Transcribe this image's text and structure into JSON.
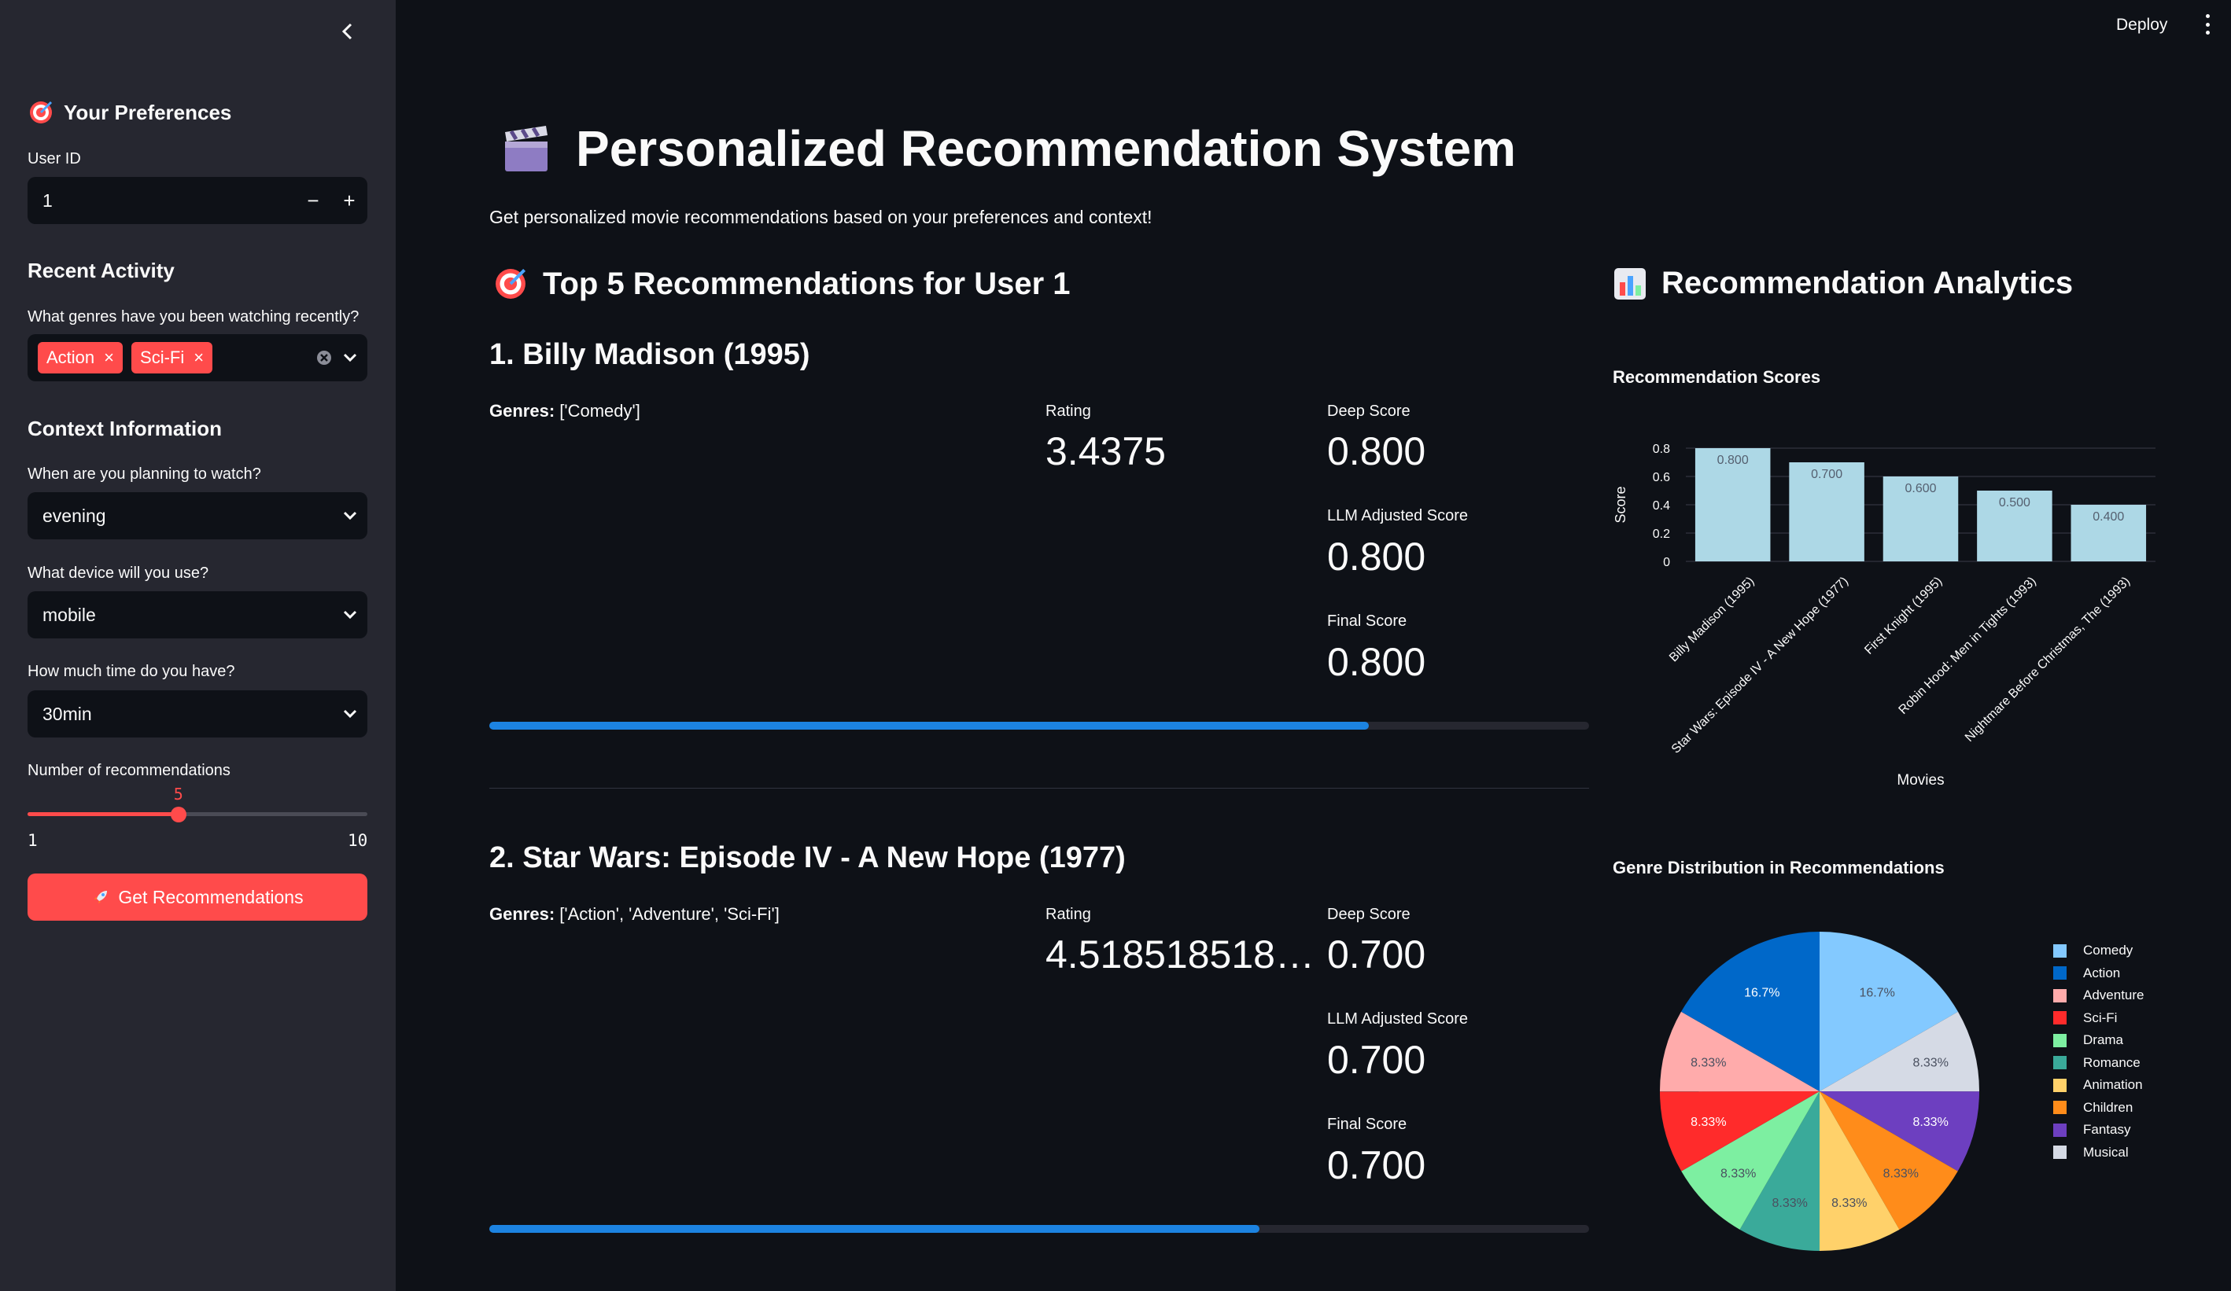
{
  "sidebar": {
    "preferences_title": "Your Preferences",
    "user_id_label": "User ID",
    "user_id_value": "1",
    "recent_activity_title": "Recent Activity",
    "genres_question": "What genres have you been watching recently?",
    "selected_genres": [
      "Action",
      "Sci-Fi"
    ],
    "context_title": "Context Information",
    "time_question": "When are you planning to watch?",
    "time_value": "evening",
    "device_question": "What device will you use?",
    "device_value": "mobile",
    "duration_question": "How much time do you have?",
    "duration_value": "30min",
    "num_recs_label": "Number of recommendations",
    "num_recs_value": "5",
    "num_recs_min": "1",
    "num_recs_max": "10",
    "slider_fraction": 0.444,
    "button_label": "Get Recommendations"
  },
  "header": {
    "deploy_label": "Deploy"
  },
  "main": {
    "title": "Personalized Recommendation System",
    "subtitle": "Get personalized movie recommendations based on your preferences and context!",
    "recs_header": "Top 5 Recommendations for User 1",
    "analytics_header": "Recommendation Analytics",
    "recommendations": [
      {
        "title": "1. Billy Madison (1995)",
        "genres_label": "Genres:",
        "genres": "['Comedy']",
        "rating_label": "Rating",
        "rating": "3.4375",
        "deep_label": "Deep Score",
        "deep": "0.800",
        "llm_label": "LLM Adjusted Score",
        "llm": "0.800",
        "final_label": "Final Score",
        "final": "0.800",
        "progress": 0.8
      },
      {
        "title": "2. Star Wars: Episode IV - A New Hope (1977)",
        "genres_label": "Genres:",
        "genres": "['Action', 'Adventure', 'Sci-Fi']",
        "rating_label": "Rating",
        "rating": "4.518518518…",
        "deep_label": "Deep Score",
        "deep": "0.700",
        "llm_label": "LLM Adjusted Score",
        "llm": "0.700",
        "final_label": "Final Score",
        "final": "0.700",
        "progress": 0.7
      }
    ]
  },
  "chart_data": [
    {
      "type": "bar",
      "title": "Recommendation Scores",
      "xlabel": "Movies",
      "ylabel": "Score",
      "categories": [
        "Billy Madison (1995)",
        "Star Wars: Episode IV - A New Hope (1977)",
        "First Knight (1995)",
        "Robin Hood: Men in Tights (1993)",
        "Nightmare Before Christmas, The (1993)"
      ],
      "values": [
        0.8,
        0.7,
        0.6,
        0.5,
        0.4
      ],
      "value_labels": [
        "0.800",
        "0.700",
        "0.600",
        "0.500",
        "0.400"
      ],
      "yticks": [
        "0",
        "0.2",
        "0.4",
        "0.6",
        "0.8"
      ],
      "ylim": [
        0,
        0.8
      ],
      "color": "#add8e6",
      "grid": true
    },
    {
      "type": "pie",
      "title": "Genre Distribution in Recommendations",
      "legend_position": "right",
      "slices": [
        {
          "label": "Comedy",
          "value": 16.7,
          "text": "16.7%",
          "color": "#83c9ff"
        },
        {
          "label": "Musical",
          "value": 8.33,
          "text": "8.33%",
          "color": "#d5dae5"
        },
        {
          "label": "Fantasy",
          "value": 8.33,
          "text": "8.33%",
          "color": "#6d3fc0"
        },
        {
          "label": "Children",
          "value": 8.33,
          "text": "8.33%",
          "color": "#ff8c1a"
        },
        {
          "label": "Animation",
          "value": 8.33,
          "text": "8.33%",
          "color": "#ffd16a"
        },
        {
          "label": "Romance",
          "value": 8.33,
          "text": "8.33%",
          "color": "#3aaa9a"
        },
        {
          "label": "Drama",
          "value": 8.33,
          "text": "8.33%",
          "color": "#7defa1"
        },
        {
          "label": "Sci-Fi",
          "value": 8.33,
          "text": "8.33%",
          "color": "#ff2b2b"
        },
        {
          "label": "Adventure",
          "value": 8.33,
          "text": "8.33%",
          "color": "#ffabab"
        },
        {
          "label": "Action",
          "value": 16.7,
          "text": "16.7%",
          "color": "#0068c9"
        }
      ],
      "legend_order": [
        "Comedy",
        "Action",
        "Adventure",
        "Sci-Fi",
        "Drama",
        "Romance",
        "Animation",
        "Children",
        "Fantasy",
        "Musical"
      ]
    }
  ]
}
